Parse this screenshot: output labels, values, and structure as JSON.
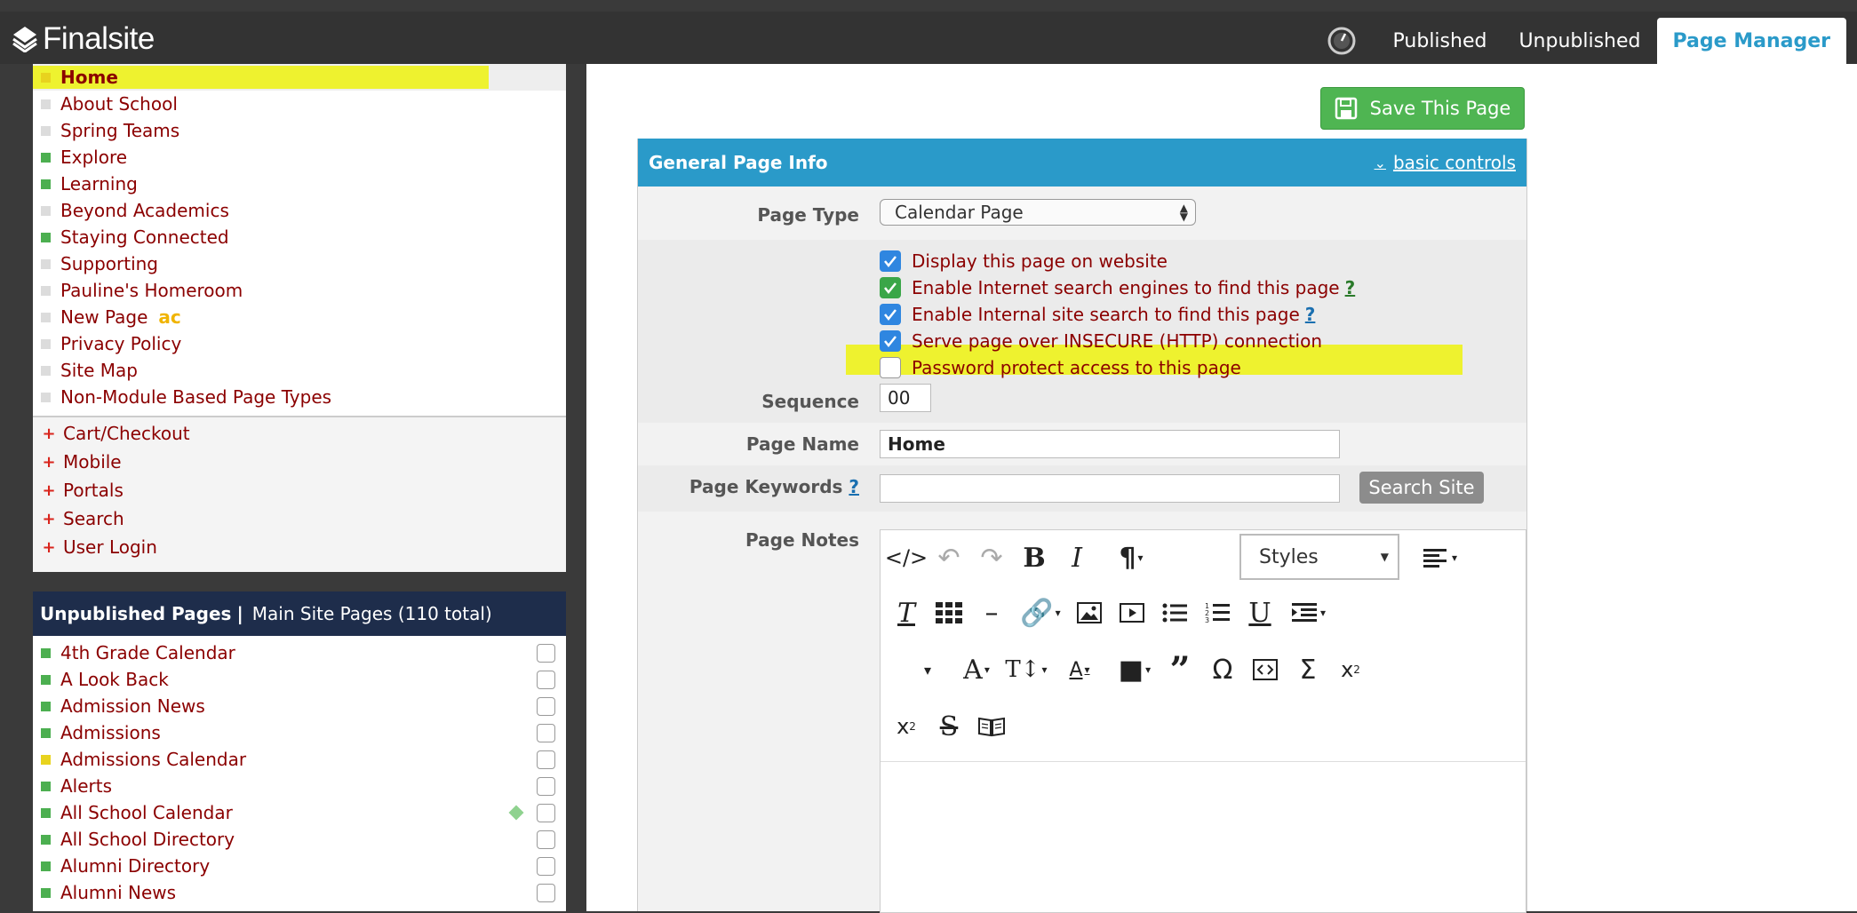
{
  "header": {
    "logo": "Finalsite",
    "tabs": [
      {
        "label": "Published"
      },
      {
        "label": "Unpublished"
      },
      {
        "label": "Page Manager"
      }
    ]
  },
  "tree": {
    "items": [
      {
        "label": "Home",
        "status": "yellow"
      },
      {
        "label": "About School",
        "status": "gray"
      },
      {
        "label": "Spring Teams",
        "status": "gray"
      },
      {
        "label": "Explore",
        "status": "green"
      },
      {
        "label": "Learning",
        "status": "green"
      },
      {
        "label": "Beyond Academics",
        "status": "gray"
      },
      {
        "label": "Staying Connected",
        "status": "green"
      },
      {
        "label": "Supporting",
        "status": "gray"
      },
      {
        "label": "Pauline's Homeroom",
        "status": "gray"
      },
      {
        "label": "New Page",
        "status": "gray",
        "badge": "ac"
      },
      {
        "label": "Privacy Policy",
        "status": "gray"
      },
      {
        "label": "Site Map",
        "status": "gray"
      },
      {
        "label": "Non-Module Based Page Types",
        "status": "gray"
      }
    ],
    "modules": [
      "Cart/Checkout",
      "Mobile",
      "Portals",
      "Search",
      "User Login"
    ]
  },
  "unpublished": {
    "title": "Unpublished Pages",
    "subtitle": "Main Site Pages (110 total)",
    "rows": [
      {
        "label": "4th Grade Calendar",
        "status": "green"
      },
      {
        "label": "A Look Back",
        "status": "green"
      },
      {
        "label": "Admission News",
        "status": "green"
      },
      {
        "label": "Admissions",
        "status": "green"
      },
      {
        "label": "Admissions Calendar",
        "status": "yellow"
      },
      {
        "label": "Alerts",
        "status": "green"
      },
      {
        "label": "All School Calendar",
        "status": "green",
        "diamond": true
      },
      {
        "label": "All School Directory",
        "status": "green"
      },
      {
        "label": "Alumni Directory",
        "status": "green"
      },
      {
        "label": "Alumni News",
        "status": "green"
      }
    ]
  },
  "main": {
    "save_label": "Save This Page",
    "panel_title": "General Page Info",
    "basic_controls": "basic controls",
    "page_type_label": "Page Type",
    "page_type_value": "Calendar Page",
    "checkboxes": [
      {
        "label": "Display this page on website",
        "checked": true
      },
      {
        "label": "Enable Internet search engines to find this page",
        "checked": true,
        "help": "?"
      },
      {
        "label": "Enable Internal site search to find this page",
        "checked": true,
        "help": "?"
      },
      {
        "label": "Serve page over INSECURE (HTTP) connection",
        "checked": true
      },
      {
        "label": "Password protect access to this page",
        "checked": false
      }
    ],
    "sequence_label": "Sequence",
    "sequence_value": "00",
    "page_name_label": "Page Name",
    "page_name_value": "Home",
    "keywords_label": "Page Keywords",
    "keywords_help": "?",
    "keywords_value": "",
    "search_site_label": "Search Site",
    "notes_label": "Page Notes",
    "styles_label": "Styles"
  },
  "colors": {
    "topbar": "#333333",
    "accent": "#2a9ac9",
    "link": "#8b0000",
    "save": "#4fb552",
    "highlight": "#eef22f"
  }
}
